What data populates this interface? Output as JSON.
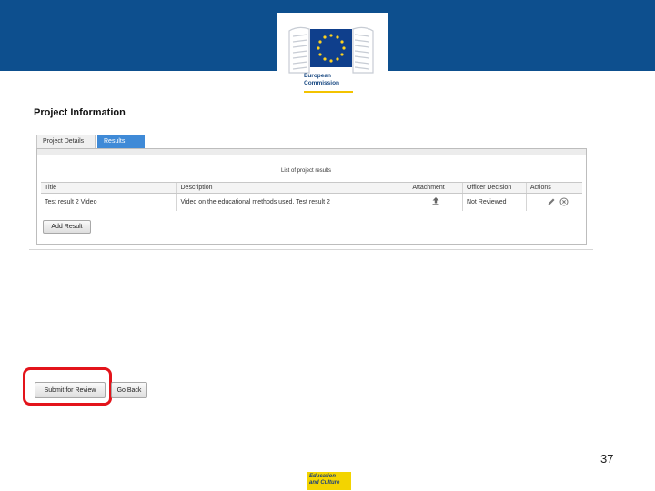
{
  "logo": {
    "line1": "European",
    "line2": "Commission"
  },
  "page": {
    "title": "Project Information"
  },
  "tabs": [
    {
      "label": "Project Details",
      "active": false
    },
    {
      "label": "Results",
      "active": true
    }
  ],
  "results": {
    "caption": "List of project results",
    "headers": {
      "title": "Title",
      "description": "Description",
      "attachment": "Attachment",
      "officer": "Officer Decision",
      "actions": "Actions"
    },
    "rows": [
      {
        "title": "Test result 2 Video",
        "description": "Video on the educational methods used. Test result 2",
        "officer": "Not Reviewed"
      }
    ],
    "add_button": "Add Result"
  },
  "footer_buttons": {
    "submit": "Submit for Review",
    "back": "Go Back"
  },
  "slide": {
    "number": "37",
    "tag_line1": "Education",
    "tag_line2": "and Culture"
  },
  "colors": {
    "header": "#0d4f8e",
    "active_tab": "#3f8ad7",
    "highlight": "#e3141b",
    "tag": "#f3d400"
  },
  "icons": {
    "attachment": "upload-arrow-icon",
    "edit": "pencil-icon",
    "delete": "circle-x-icon",
    "logo": "eu-flag-icon"
  }
}
